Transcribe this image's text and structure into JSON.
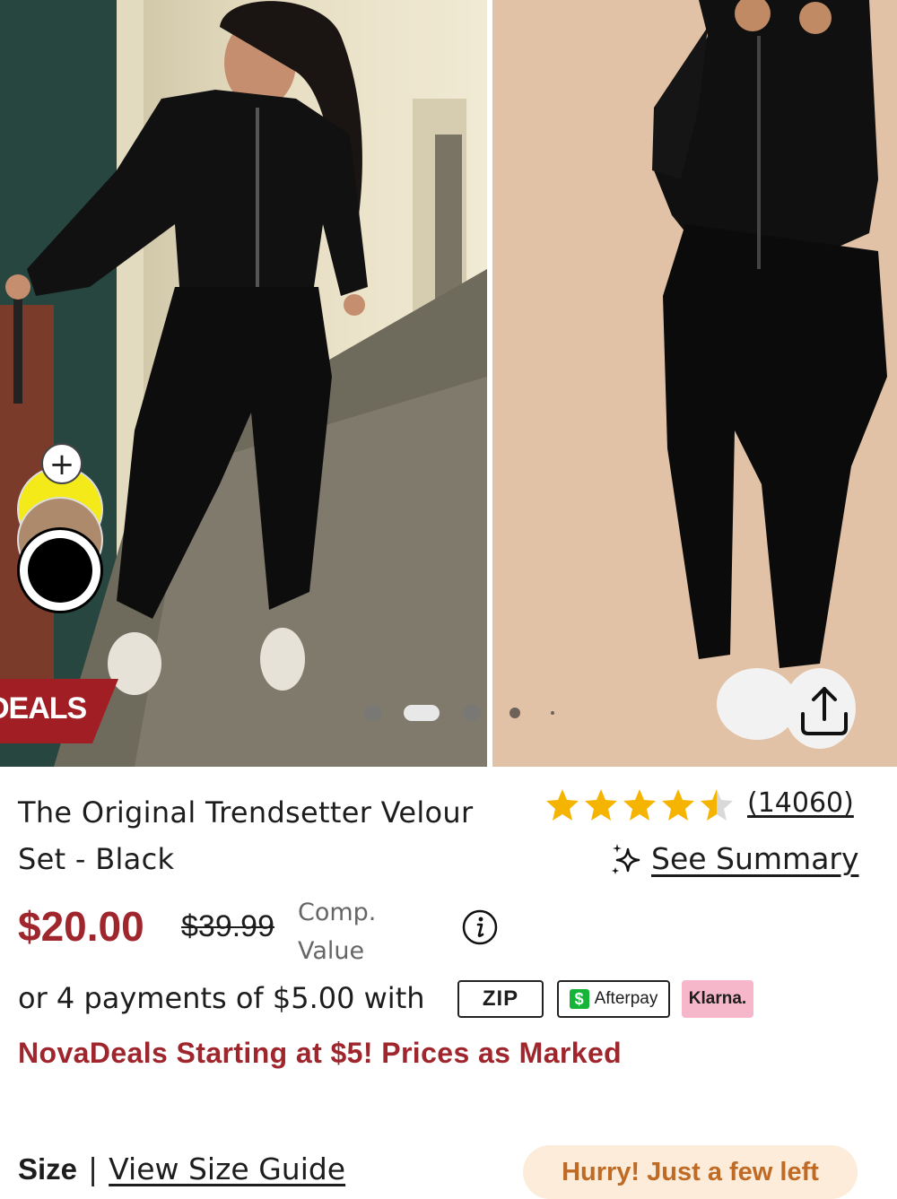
{
  "gallery": {
    "badge_label": "DEALS",
    "swatch_add_symbol": "+",
    "swatches": [
      "Yellow",
      "Tan",
      "Black"
    ],
    "selected_swatch": "Black"
  },
  "product": {
    "title": "The Original Trendsetter Velour Set - Black",
    "rating": 4.5,
    "review_count": "(14060)",
    "summary_label": "See Summary",
    "price": "$20.00",
    "compare_price": "$39.99",
    "compare_label": "Comp. Value",
    "installments_text": "or 4 payments of $5.00 with",
    "payment_providers": {
      "zip": "ZIP",
      "afterpay": "Afterpay",
      "klarna": "Klarna."
    },
    "promo_text": "NovaDeals Starting at $5! Prices as Marked"
  },
  "size": {
    "label": "Size",
    "separator": "|",
    "guide_link": "View Size Guide",
    "stock_notice": "Hurry! Just a few left"
  },
  "colors": {
    "price_red": "#a0262d",
    "star_gold": "#f5b400",
    "badge_red": "#a21e25",
    "stock_orange": "#bf6b25"
  }
}
